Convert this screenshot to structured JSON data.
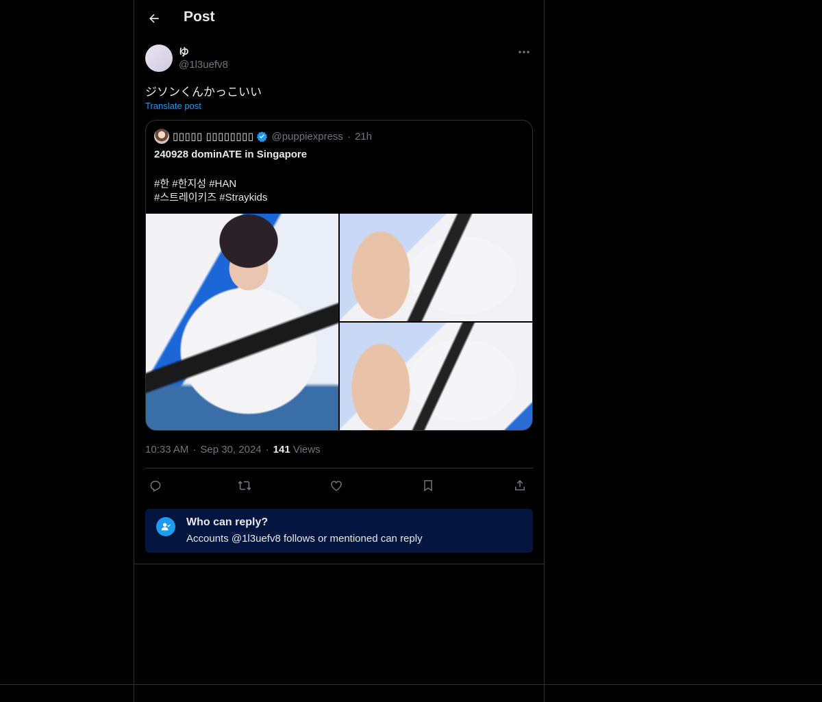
{
  "header": {
    "title": "Post",
    "back_icon": "arrow-left-icon"
  },
  "author": {
    "display_name": "ゆ",
    "handle": "@1l3uefv8"
  },
  "post": {
    "text": "ジソンくんかっこいい",
    "translate_label": "Translate post"
  },
  "quoted_post": {
    "display_name": "▯▯▯▯▯ ▯▯▯▯▯▯▯▯",
    "handle": "@puppiexpress",
    "time": "21h",
    "verified": true,
    "title": "240928 dominATE in Singapore",
    "tags_line1": "#한 #한지성 #HAN",
    "tags_line2": "#스트레이키즈 #Straykids",
    "media_count": 3
  },
  "meta": {
    "time": "10:33 AM",
    "date": "Sep 30, 2024",
    "views_count": "141",
    "views_label": "Views",
    "separator": "·"
  },
  "actions": [
    "reply-icon",
    "repost-icon",
    "like-icon",
    "bookmark-icon",
    "share-icon"
  ],
  "reply_settings": {
    "title": "Who can reply?",
    "subtitle": "Accounts @1l3uefv8 follows or mentioned can reply"
  },
  "colors": {
    "background": "#000000",
    "text": "#e7e9ea",
    "muted": "#71767b",
    "accent": "#1d9bf0",
    "reply_box": "#041540"
  }
}
